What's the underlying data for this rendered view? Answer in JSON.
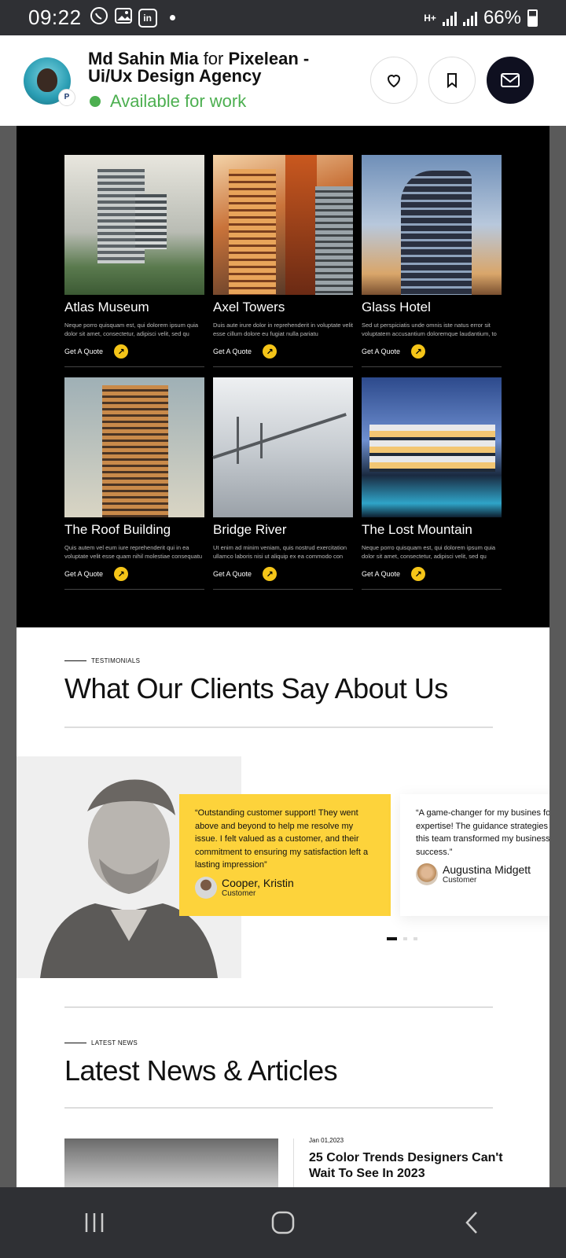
{
  "status_bar": {
    "time": "09:22",
    "network": "H+",
    "battery": "66%"
  },
  "header": {
    "name": "Md Sahin Mia",
    "for_word": "for",
    "company": "Pixelean - Ui/Ux Design Agency",
    "availability": "Available for work",
    "avatar_badge": "P"
  },
  "projects": {
    "cta_label": "Get A Quote",
    "items": [
      {
        "title": "Atlas Museum",
        "desc": "Neque porro quisquam est, qui dolorem ipsum quia dolor sit amet, consectetur, adipisci velit, sed qu"
      },
      {
        "title": "Axel Towers",
        "desc": "Duis aute irure dolor in reprehenderit in voluptate velit esse cillum dolore eu fugiat nulla pariatu"
      },
      {
        "title": "Glass Hotel",
        "desc": "Sed ut perspiciatis unde omnis iste natus error sit voluptatem accusantium doloremque laudantium, to"
      },
      {
        "title": "The Roof Building",
        "desc": "Quis autem vel eum iure reprehenderit qui in ea voluptate velit esse quam nihil molestiae consequatu"
      },
      {
        "title": "Bridge River",
        "desc": "Ut enim ad minim veniam, quis nostrud exercitation ullamco laboris nisi ut aliquip ex ea commodo con"
      },
      {
        "title": "The Lost Mountain",
        "desc": "Neque porro quisquam est, qui dolorem ipsum quia dolor sit amet, consectetur, adipisci velit, sed qu"
      }
    ]
  },
  "testimonials": {
    "label": "TESTIMONIALS",
    "title": "What Our Clients Say About Us",
    "cards": [
      {
        "text": "“Outstanding customer support! They went above and beyond to help me resolve my issue. I felt valued as a customer, and their commitment to ensuring my satisfaction left a lasting impression”",
        "name": "Cooper, Kristin",
        "role": "Customer"
      },
      {
        "text": "“A game-changer for my busines for your expertise! The guidance strategies provided by this team transformed my business into a t success.”",
        "name": "Augustina Midgett",
        "role": "Customer"
      }
    ]
  },
  "news": {
    "label": "LATEST NEWS",
    "title": "Latest News & Articles",
    "first_date": "Jan 01,2023",
    "first_title": "25 Color Trends Designers Can't Wait To See In 2023"
  },
  "colors": {
    "accent": "#f5c518",
    "testimonial_card": "#fdd33b",
    "available": "#4caf50",
    "dark": "#0f1020"
  }
}
